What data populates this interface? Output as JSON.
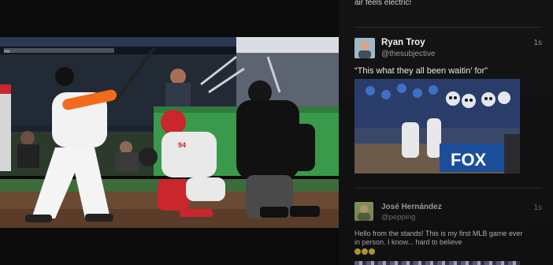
{
  "video": {
    "scoreboard_text": "Hel",
    "catcher_number": "94"
  },
  "feed": {
    "previous_post_text": "air feels electric!",
    "posts": [
      {
        "name": "Ryan Troy",
        "handle": "@thesubjective",
        "time": "1s",
        "text": "“This what they all been waitin’ for”",
        "photo_overlay": "FOX"
      },
      {
        "name": "José Hernández",
        "handle": "@pepping",
        "time": "1s",
        "text": "Hello from the stands! This is my first MLB game ever in person. I know... hard to believe"
      }
    ]
  },
  "colors": {
    "field_grass": "#3d6b3a",
    "wall_green": "#3a9a4b",
    "jersey_orange": "#f26a1b",
    "catcher_red": "#c9262e",
    "fox_blue": "#1c4f9a"
  }
}
